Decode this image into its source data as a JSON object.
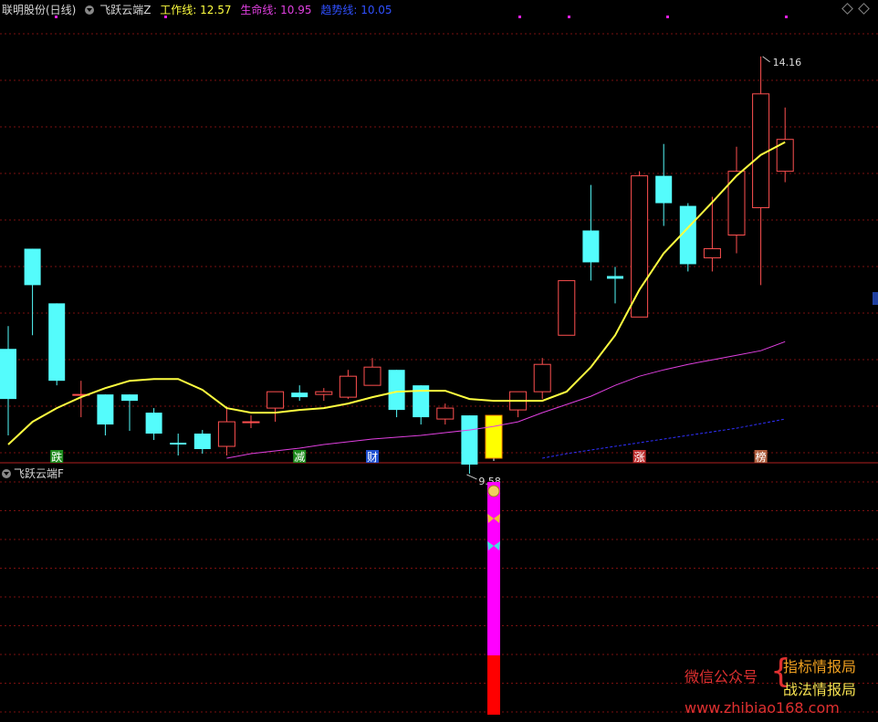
{
  "header": {
    "stock_name": "联明股份(日线)",
    "indicator_name": "飞跃云端Z",
    "work_line_label": "工作线: 12.57",
    "life_line_label": "生命线: 10.95",
    "trend_line_label": "趋势线: 10.05"
  },
  "sub_panel": {
    "title": "飞跃云端F"
  },
  "annotations": {
    "high_label": "14.16",
    "low_label": "9.58"
  },
  "markers": [
    {
      "text": "跌",
      "color": "#1e8c1e"
    },
    {
      "text": "减",
      "color": "#1e8c1e"
    },
    {
      "text": "财",
      "color": "#2050d0"
    },
    {
      "text": "涨",
      "color": "#c03030"
    },
    {
      "text": "榜",
      "color": "#b06040"
    }
  ],
  "colors": {
    "up": "#ff5050",
    "down": "#54fcfc",
    "work_line": "#ffff40",
    "life_line": "#e040e0",
    "trend_line": "#3030ff",
    "signal": "#ff00ff",
    "signal_base": "#ff0000",
    "highlight": "#ffff00",
    "grid": "#7a1010"
  },
  "watermark": {
    "gzh": "微信公众号",
    "line1": "指标情报局",
    "line2": "战法情报局",
    "url": "www.zhibiao168.com"
  },
  "chart_data": {
    "type": "candlestick",
    "candles": [
      {
        "o": 10.95,
        "h": 11.2,
        "l": 10.0,
        "c": 10.4
      },
      {
        "o": 12.05,
        "h": 12.05,
        "l": 11.1,
        "c": 11.65
      },
      {
        "o": 11.45,
        "h": 11.45,
        "l": 10.55,
        "c": 10.6
      },
      {
        "o": 10.45,
        "h": 10.6,
        "l": 10.2,
        "c": 10.45
      },
      {
        "o": 10.45,
        "h": 10.45,
        "l": 10.0,
        "c": 10.12
      },
      {
        "o": 10.45,
        "h": 10.45,
        "l": 10.05,
        "c": 10.38
      },
      {
        "o": 10.25,
        "h": 10.3,
        "l": 9.95,
        "c": 10.02
      },
      {
        "o": 9.92,
        "h": 10.02,
        "l": 9.78,
        "c": 9.9
      },
      {
        "o": 10.02,
        "h": 10.06,
        "l": 9.8,
        "c": 9.85
      },
      {
        "o": 9.88,
        "h": 10.32,
        "l": 9.78,
        "c": 10.15
      },
      {
        "o": 10.15,
        "h": 10.22,
        "l": 10.08,
        "c": 10.15
      },
      {
        "o": 10.3,
        "h": 10.3,
        "l": 10.15,
        "c": 10.48
      },
      {
        "o": 10.47,
        "h": 10.55,
        "l": 10.38,
        "c": 10.42
      },
      {
        "o": 10.45,
        "h": 10.52,
        "l": 10.38,
        "c": 10.48
      },
      {
        "o": 10.42,
        "h": 10.72,
        "l": 10.4,
        "c": 10.65
      },
      {
        "o": 10.55,
        "h": 10.85,
        "l": 10.55,
        "c": 10.75
      },
      {
        "o": 10.72,
        "h": 10.72,
        "l": 10.2,
        "c": 10.28
      },
      {
        "o": 10.55,
        "h": 10.55,
        "l": 10.12,
        "c": 10.2
      },
      {
        "o": 10.18,
        "h": 10.35,
        "l": 10.12,
        "c": 10.3
      },
      {
        "o": 10.22,
        "h": 10.22,
        "l": 9.58,
        "c": 9.68
      },
      {
        "o": 10.22,
        "h": 10.22,
        "l": 9.72,
        "c": 9.75,
        "highlight": true
      },
      {
        "o": 10.28,
        "h": 10.48,
        "l": 10.2,
        "c": 10.48
      },
      {
        "o": 10.48,
        "h": 10.85,
        "l": 10.4,
        "c": 10.78
      },
      {
        "o": 11.1,
        "h": 11.7,
        "l": 11.1,
        "c": 11.7
      },
      {
        "o": 12.25,
        "h": 12.75,
        "l": 11.7,
        "c": 11.9
      },
      {
        "o": 11.75,
        "h": 11.85,
        "l": 11.45,
        "c": 11.72
      },
      {
        "o": 11.3,
        "h": 12.9,
        "l": 11.3,
        "c": 12.85
      },
      {
        "o": 12.85,
        "h": 13.2,
        "l": 12.3,
        "c": 12.55
      },
      {
        "o": 12.52,
        "h": 12.55,
        "l": 11.8,
        "c": 11.88
      },
      {
        "o": 11.95,
        "h": 12.62,
        "l": 11.8,
        "c": 12.05
      },
      {
        "o": 12.2,
        "h": 13.17,
        "l": 12.0,
        "c": 12.9
      },
      {
        "o": 12.5,
        "h": 14.16,
        "l": 11.65,
        "c": 13.75
      },
      {
        "o": 12.9,
        "h": 13.6,
        "l": 12.78,
        "c": 13.25
      }
    ],
    "work_line": [
      9.9,
      10.15,
      10.3,
      10.42,
      10.52,
      10.6,
      10.62,
      10.62,
      10.5,
      10.3,
      10.25,
      10.25,
      10.28,
      10.3,
      10.35,
      10.42,
      10.48,
      10.49,
      10.49,
      10.4,
      10.38,
      10.38,
      10.38,
      10.48,
      10.75,
      11.1,
      11.6,
      12.0,
      12.28,
      12.56,
      12.85,
      13.08,
      13.22
    ],
    "life_line_start_index": 9,
    "life_line": [
      9.75,
      9.8,
      9.83,
      9.86,
      9.9,
      9.93,
      9.96,
      9.98,
      10.0,
      10.03,
      10.06,
      10.1,
      10.15,
      10.25,
      10.34,
      10.43,
      10.55,
      10.65,
      10.72,
      10.78,
      10.83,
      10.88,
      10.93,
      11.03
    ],
    "trend_line_start_index": 22,
    "trend_line": [
      9.75,
      9.8,
      9.84,
      9.88,
      9.92,
      9.96,
      10.0,
      10.04,
      10.08,
      10.13,
      10.18
    ],
    "markers": [
      {
        "index": 2,
        "text": "跌"
      },
      {
        "index": 12,
        "text": "减"
      },
      {
        "index": 15,
        "text": "财"
      },
      {
        "index": 26,
        "text": "涨"
      },
      {
        "index": 31,
        "text": "榜"
      }
    ],
    "signal": {
      "index": 20,
      "value": 1.0
    },
    "ylim": [
      9.8,
      14.6
    ],
    "grid": true
  }
}
